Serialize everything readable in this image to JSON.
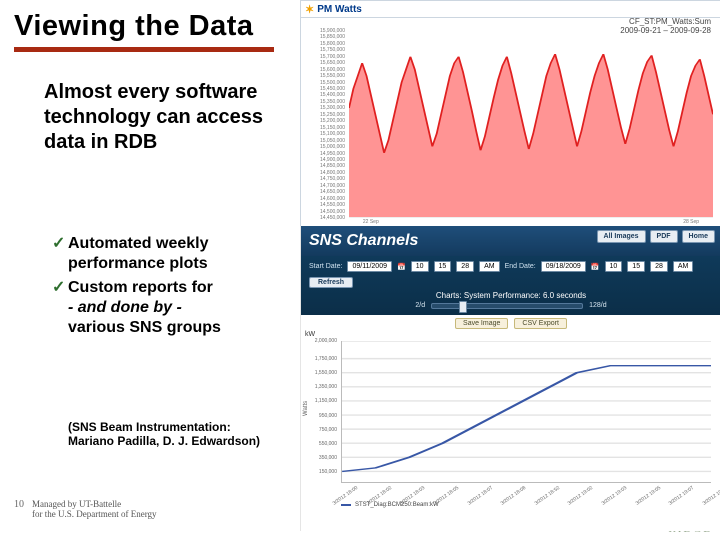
{
  "title": "Viewing the Data",
  "subtitle": "Almost every software technology can access data in RDB",
  "bullets": [
    "Automated weekly performance plots",
    "Custom reports for\n- and done by -\nvarious SNS groups"
  ],
  "credits": "(SNS Beam Instrumentation:\n Mariano Padilla, D. J. Edwardson)",
  "page_num": "10",
  "managed": "Managed by UT-Battelle\nfor the U.S. Department of Energy",
  "logo_top": "OAK",
  "logo_bot": "RIDGE",
  "pmwatts": {
    "name": "PM Watts",
    "title_line1": "CF_ST:PM_Watts:Sum",
    "title_line2": "2009-09-21 – 2009-09-28",
    "xlabel_left": "22 Sep",
    "xlabel_right": "28 Sep"
  },
  "sns": {
    "banner": "SNS Channels",
    "nav": {
      "all": "All Images",
      "pdf": "PDF",
      "home": "Home"
    },
    "row1": {
      "start_label": "Start Date:",
      "start_date": "09/11/2009",
      "start_time_h": "10",
      "start_time_m": "15",
      "start_time_s": "28",
      "start_time_ampm": "AM",
      "end_label": "End Date:",
      "end_date": "09/18/2009",
      "end_time_h": "10",
      "end_time_m": "15",
      "end_time_s": "28",
      "end_time_ampm": "AM",
      "refresh": "Refresh"
    },
    "chart_title": "Charts: System Performance: 6.0 seconds",
    "slider": {
      "left": "2/d",
      "right": "128/d"
    },
    "exports": {
      "save_image": "Save Image",
      "csv": "CSV Export"
    },
    "chart2": {
      "ylab": "kW",
      "yunit": "Watts"
    },
    "legend": "STST_Diag:BCM250:Beam:kW"
  },
  "chart_data": [
    {
      "type": "line",
      "title": "CF_ST:PM_Watts:Sum  2009-09-21 – 2009-09-28",
      "xlabel": "",
      "ylabel": "",
      "ylim": [
        14450000,
        15900000
      ],
      "x": [
        0,
        1,
        2,
        3,
        4,
        5,
        6,
        7,
        8,
        9,
        10,
        11,
        12,
        13,
        14,
        15,
        16,
        17,
        18,
        19,
        20,
        21,
        22,
        23,
        24,
        25,
        26,
        27,
        28,
        29,
        30,
        31,
        32,
        33,
        34,
        35,
        36,
        37,
        38,
        39,
        40,
        41,
        42,
        43,
        44,
        45,
        46,
        47,
        48,
        49,
        50,
        51,
        52,
        53,
        54,
        55,
        56,
        57,
        58,
        59,
        60,
        61,
        62,
        63,
        64,
        65,
        66,
        67,
        68,
        69,
        70,
        71,
        72,
        73,
        74,
        75,
        76,
        77,
        78,
        79,
        80,
        81,
        82,
        83
      ],
      "values": [
        15.3,
        15.45,
        15.55,
        15.65,
        15.55,
        15.4,
        15.25,
        15.1,
        14.95,
        15.05,
        15.2,
        15.35,
        15.5,
        15.6,
        15.7,
        15.6,
        15.45,
        15.3,
        15.15,
        15.0,
        15.1,
        15.25,
        15.4,
        15.55,
        15.65,
        15.7,
        15.58,
        15.43,
        15.28,
        15.12,
        14.97,
        15.08,
        15.23,
        15.38,
        15.52,
        15.63,
        15.7,
        15.57,
        15.42,
        15.27,
        15.12,
        14.98,
        15.1,
        15.25,
        15.4,
        15.55,
        15.65,
        15.72,
        15.6,
        15.45,
        15.3,
        15.15,
        15.0,
        15.12,
        15.27,
        15.42,
        15.55,
        15.65,
        15.72,
        15.6,
        15.45,
        15.3,
        15.15,
        15.02,
        15.14,
        15.29,
        15.44,
        15.57,
        15.66,
        15.71,
        15.58,
        15.43,
        15.28,
        15.13,
        15.0,
        15.12,
        15.27,
        15.42,
        15.55,
        15.63,
        15.68,
        15.55,
        15.4,
        15.25
      ],
      "yticks": [
        14450000,
        14500000,
        14550000,
        14600000,
        14650000,
        14700000,
        14750000,
        14800000,
        14850000,
        14900000,
        14950000,
        15000000,
        15050000,
        15100000,
        15150000,
        15200000,
        15250000,
        15300000,
        15350000,
        15400000,
        15450000,
        15500000,
        15550000,
        15600000,
        15650000,
        15700000,
        15750000,
        15800000,
        15850000,
        15900000
      ]
    },
    {
      "type": "line",
      "title": "Charts: System Performance: 6.0 seconds",
      "xlabel": "",
      "ylabel": "kW",
      "ylim": [
        0,
        2000000
      ],
      "x": [
        "3/2012 18:00",
        "3/2012 18:02",
        "3/2012 18:03",
        "3/2012 18:05",
        "3/2012 18:07",
        "3/2012 18:08",
        "3/2012 18:52",
        "3/2012 19:02",
        "3/2012 19:03",
        "3/2012 19:05",
        "3/2012 19:07",
        "3/2012 19:08"
      ],
      "series": [
        {
          "name": "STST_Diag:BCM250:Beam:kW",
          "values": [
            150000,
            200000,
            350000,
            550000,
            800000,
            1050000,
            1300000,
            1550000,
            1650000,
            1650000,
            1650000,
            1650000
          ]
        }
      ],
      "yticks": [
        150000,
        350000,
        550000,
        750000,
        950000,
        1150000,
        1350000,
        1550000,
        1750000,
        2000000
      ]
    }
  ]
}
